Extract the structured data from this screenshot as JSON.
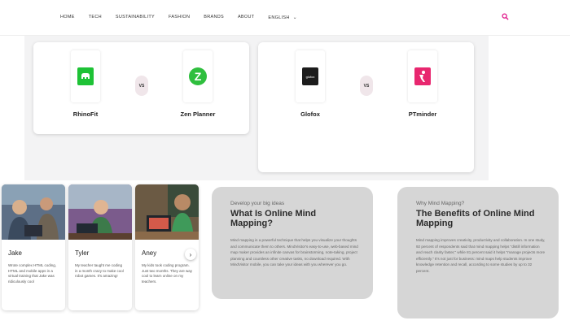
{
  "nav": {
    "links": [
      "HOME",
      "TECH",
      "SUSTAINABILITY",
      "FASHION",
      "BRANDS",
      "ABOUT"
    ],
    "language": "ENGLISH"
  },
  "compare": [
    {
      "left": {
        "name": "RhinoFit",
        "color": "#1ec236"
      },
      "vs": "VS",
      "right": {
        "name": "Zen Planner",
        "color": "#2fbf3e"
      }
    },
    {
      "left": {
        "name": "Glofox",
        "color": "#1c1c1c",
        "logo_text": "glofox"
      },
      "vs": "VS",
      "right": {
        "name": "PTminder",
        "color": "#e8276f"
      }
    }
  ],
  "profiles": [
    {
      "name": "Jake",
      "desc": "Wrote complex HTML coding, HTML and mobile apps in a virtual training that Jake was ridiculously cool"
    },
    {
      "name": "Tyler",
      "desc": "My teacher taught me coding in a month crazy to make cool robot games. It's amazing!"
    },
    {
      "name": "Aney",
      "desc": "My kids took coding program. Just two months. They are way cool to learn online on my teachers."
    }
  ],
  "info": [
    {
      "kicker": "Develop your big ideas",
      "title": "What Is Online Mind Mapping?",
      "body": "Mind mapping is a powerful technique that helps you visualize your thoughts and communicate them to others. MindVisitor's easy-to-use, web-based mind map maker provides an infinite canvas for brainstorming, note-taking, project planning and countless other creative tasks, no download required. With MindVisitor mobile, you can take your ideas with you wherever you go."
    },
    {
      "kicker": "Why Mind Mapping?",
      "title": "The Benefits of Online Mind Mapping",
      "body": "Mind mapping improves creativity, productivity and collaboration. In one study, 92 percent of respondents said that mind mapping helps \"distill information and reach clarity faster,\" while 81 percent said it helps \"manage projects more efficiently.\" It's not just for business: mind maps help students improve knowledge retention and recall, according to some studies by up to 32 percent."
    }
  ],
  "colors": {
    "accent": "#e0178a",
    "info_bg": "#d6d6d6"
  }
}
